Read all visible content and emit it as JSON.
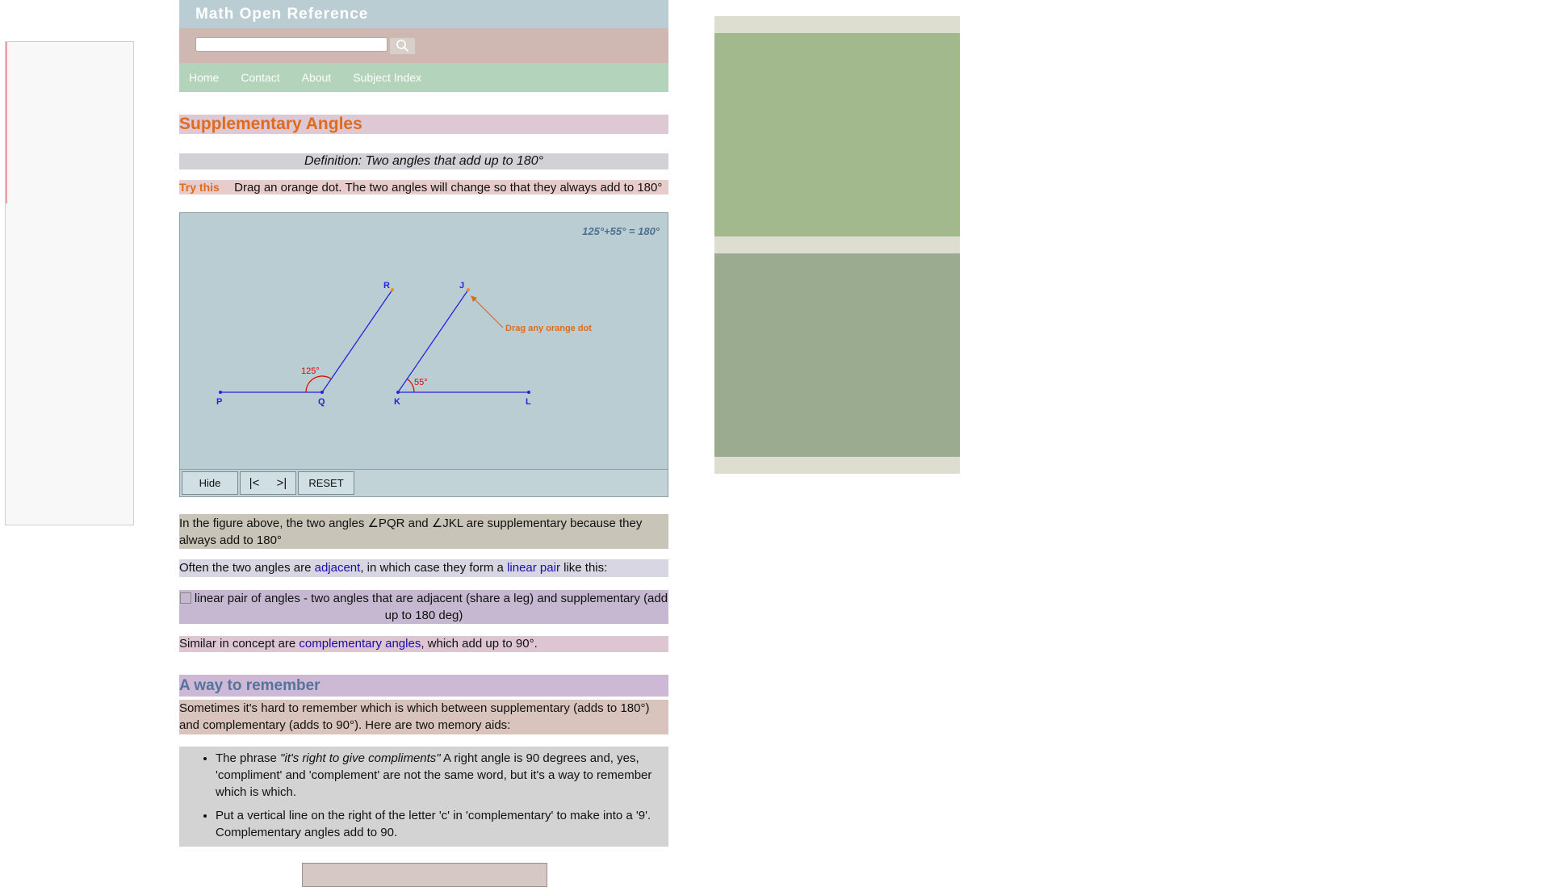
{
  "site": {
    "title": "Math Open Reference",
    "search": {
      "value": "",
      "placeholder": ""
    },
    "nav": [
      "Home",
      "Contact",
      "About",
      "Subject Index"
    ]
  },
  "page": {
    "title": "Supplementary Angles",
    "definition": "Definition: Two angles that add up to 180°",
    "try_label": "Try this",
    "try_text": "Drag an orange dot. The two angles will change so that they always add to 180°"
  },
  "applet": {
    "equation": "125°+55° = 180°",
    "labels": {
      "P": "P",
      "Q": "Q",
      "R": "R",
      "J": "J",
      "K": "K",
      "L": "L"
    },
    "angle_pqr": "125°",
    "angle_jkl": "55°",
    "hint": "Drag any orange dot",
    "controls": {
      "hide": "Hide",
      "prev": "|<",
      "next": ">|",
      "reset": "RESET"
    },
    "colors": {
      "line": "#2323e0",
      "angle": "#e00000",
      "hint": "#e06b1c"
    }
  },
  "content": {
    "para1": "In the figure above, the two angles ∠PQR and ∠JKL are supplementary because they always add to 180°",
    "para2": {
      "pre": "Often the two angles are ",
      "link1": "adjacent",
      "mid": ", in which case they form a ",
      "link2": "linear pair",
      "post": " like this:"
    },
    "image_alt": "linear pair of angles - two angles that are adjacent (share a leg) and supplementary (add up to 180 deg)",
    "para3": {
      "pre": "Similar in concept are ",
      "link": "complementary angles",
      "post": ", which add up to 90°."
    },
    "section2_title": "A way to remember",
    "para4": "Sometimes it's hard to remember which is which between supplementary (adds to 180°) and complementary (adds to 90°). Here are two memory aids:",
    "aid1": {
      "pre": "The phrase ",
      "quote": "\"it's right to give compliments\"",
      "post": " A right angle is 90 degrees and, yes, 'compliment' and 'complement' are not the same word, but it's a way to remember which is which."
    },
    "aid2": "Put a vertical line on the right of the letter 'c' in 'complementary' to make into a '9'. Complementary angles add to 90."
  }
}
